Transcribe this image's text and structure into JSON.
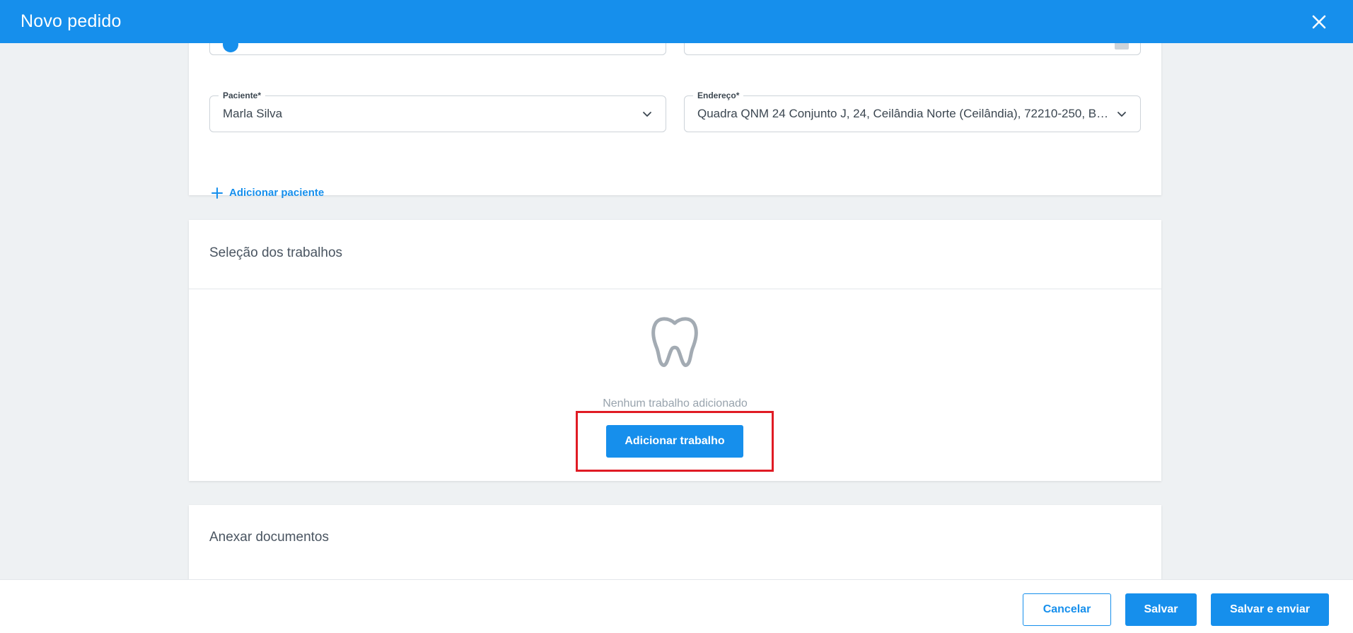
{
  "header": {
    "title": "Novo pedido"
  },
  "patient_section": {
    "patient_field": {
      "label": "Paciente",
      "required_mark": "*",
      "value": "Marla Silva"
    },
    "address_field": {
      "label": "Endereço",
      "required_mark": "*",
      "value": "Quadra QNM 24 Conjunto J, 24, Ceilândia Norte (Ceilândia), 72210-250, Br..."
    },
    "add_patient_label": "Adicionar paciente"
  },
  "works_section": {
    "title": "Seleção dos trabalhos",
    "empty_text": "Nenhum trabalho adicionado",
    "add_work_label": "Adicionar trabalho"
  },
  "docs_section": {
    "title": "Anexar documentos"
  },
  "footer": {
    "cancel_label": "Cancelar",
    "save_label": "Salvar",
    "save_send_label": "Salvar e enviar"
  },
  "icons": {
    "close": "close-icon",
    "chevron": "chevron-down-icon",
    "plus": "plus-icon",
    "tooth": "tooth-icon"
  },
  "colors": {
    "primary": "#168fec",
    "highlight": "#e01b24",
    "background": "#eef1f3"
  }
}
